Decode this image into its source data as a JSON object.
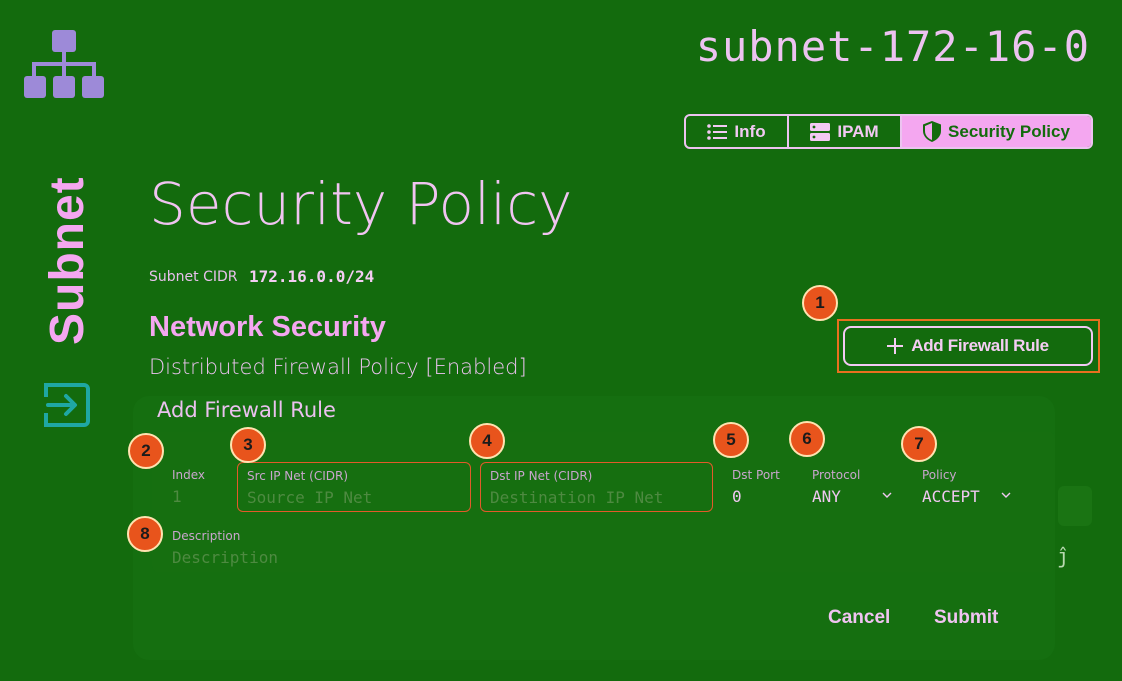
{
  "sidebar": {
    "logo_icon": "network-hierarchy-icon",
    "title": "Subnet",
    "exit_icon": "logout-icon"
  },
  "header": {
    "subnet_name": "subnet-172-16-0"
  },
  "tabs": [
    {
      "label": "Info",
      "icon": "list-icon",
      "active": false
    },
    {
      "label": "IPAM",
      "icon": "server-icon",
      "active": false
    },
    {
      "label": "Security Policy",
      "icon": "shield-icon",
      "active": true
    }
  ],
  "page": {
    "title": "Security Policy",
    "cidr_label": "Subnet CIDR",
    "cidr_value": "172.16.0.0/24",
    "section_title": "Network Security",
    "section_subtitle": "Distributed Firewall Policy [Enabled]",
    "add_rule_button": "Add Firewall Rule"
  },
  "form": {
    "title": "Add Firewall Rule",
    "index": {
      "label": "Index",
      "placeholder": "1"
    },
    "src": {
      "label": "Src IP Net (CIDR)",
      "placeholder": "Source IP Net"
    },
    "dst": {
      "label": "Dst IP Net (CIDR)",
      "placeholder": "Destination IP Net"
    },
    "dst_port": {
      "label": "Dst Port",
      "value": "0"
    },
    "protocol": {
      "label": "Protocol",
      "value": "ANY"
    },
    "policy": {
      "label": "Policy",
      "value": "ACCEPT"
    },
    "description": {
      "label": "Description",
      "placeholder": "Description"
    },
    "cancel": "Cancel",
    "submit": "Submit"
  },
  "annotations": [
    "1",
    "2",
    "3",
    "4",
    "5",
    "6",
    "7",
    "8"
  ],
  "colors": {
    "background": "#136b0d",
    "accent": "#f4a7f0",
    "badge": "#e8541c",
    "highlight_border": "#e9701f"
  }
}
